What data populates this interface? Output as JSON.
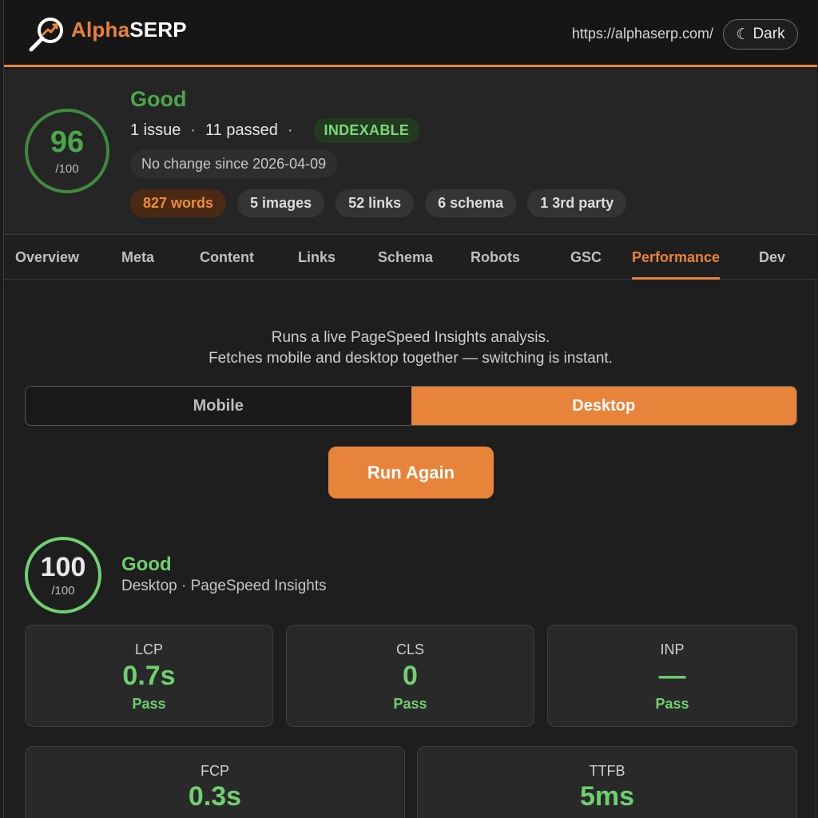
{
  "header": {
    "brand_part1": "Alpha",
    "brand_part2": "SERP",
    "url": "https://alphaserp.com/",
    "theme_icon": "☾",
    "theme_label": "Dark"
  },
  "summary": {
    "score": "96",
    "score_max": "/100",
    "status": "Good",
    "issues": "1 issue",
    "passed": "11 passed",
    "separator": "·",
    "indexable": "INDEXABLE",
    "change": "No change since 2026-04-09",
    "chips": [
      "827 words",
      "5 images",
      "52 links",
      "6 schema",
      "1 3rd party"
    ]
  },
  "tabs": [
    "Overview",
    "Meta",
    "Content",
    "Links",
    "Schema",
    "Robots",
    "GSC",
    "Performance",
    "Dev"
  ],
  "active_tab": "Performance",
  "performance": {
    "intro_line1": "Runs a live PageSpeed Insights analysis.",
    "intro_line2": "Fetches mobile and desktop together — switching is instant.",
    "mode_mobile": "Mobile",
    "mode_desktop": "Desktop",
    "active_mode": "Desktop",
    "run_button": "Run Again",
    "score": "100",
    "score_max": "/100",
    "score_label": "Good",
    "score_source": "Desktop · PageSpeed Insights",
    "metrics": [
      {
        "name": "LCP",
        "value": "0.7s",
        "status": "Pass"
      },
      {
        "name": "CLS",
        "value": "0",
        "status": "Pass"
      },
      {
        "name": "INP",
        "value": "—",
        "status": "Pass"
      },
      {
        "name": "FCP",
        "value": "0.3s"
      },
      {
        "name": "TTFB",
        "value": "5ms"
      }
    ]
  },
  "colors": {
    "accent": "#e8833a",
    "good": "#6fd06f",
    "background": "#1e1e1e"
  }
}
